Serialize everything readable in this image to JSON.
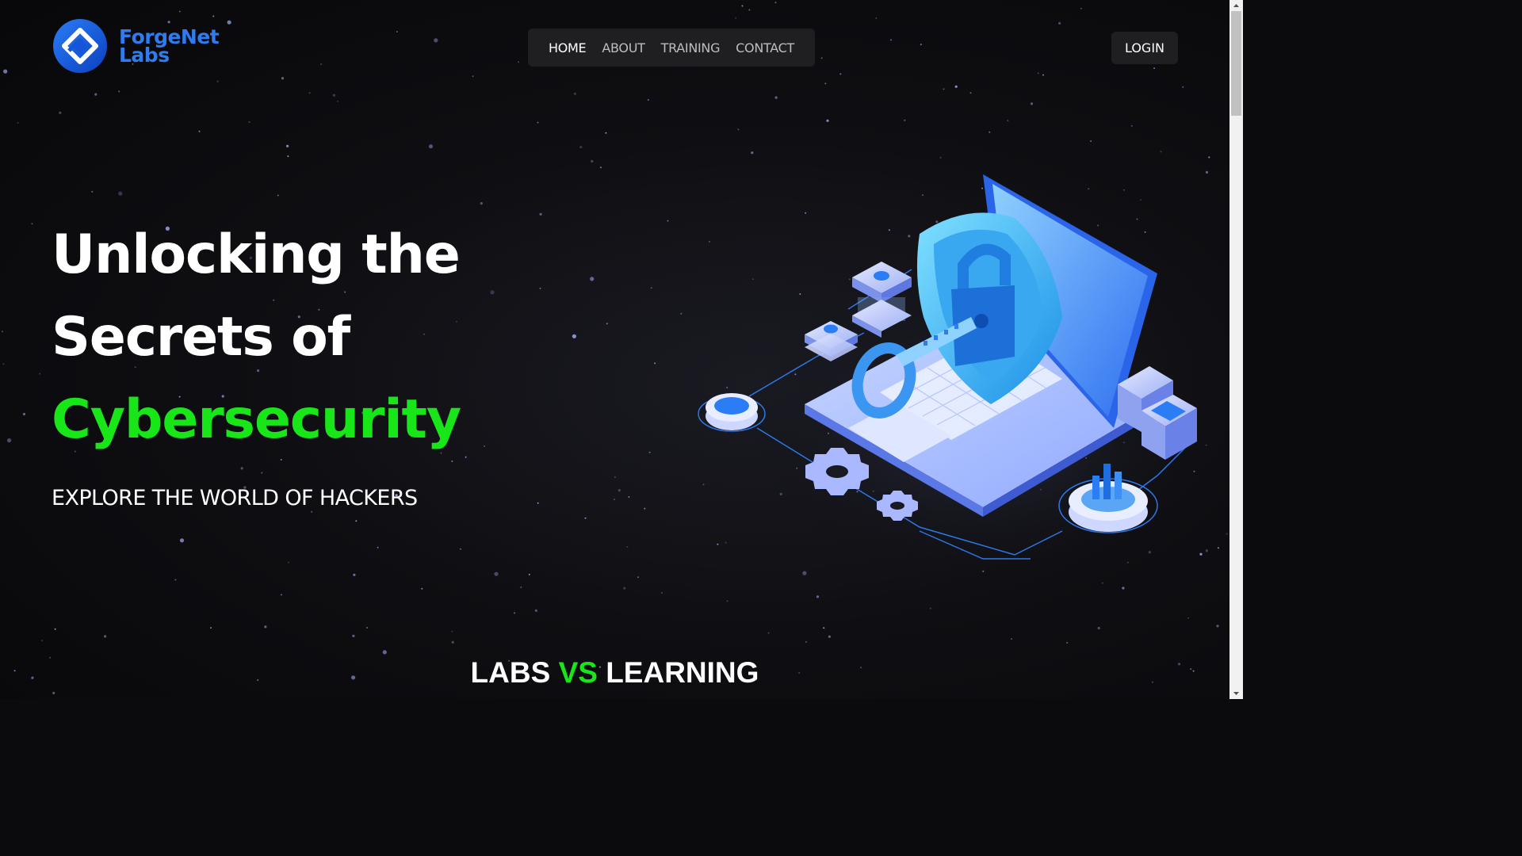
{
  "brand": {
    "name_line1": "ForgeNet",
    "name_line2": "Labs",
    "logo_icon": "diamond-logo-icon",
    "color": "#2f7cf0"
  },
  "nav": {
    "items": [
      {
        "label": "HOME",
        "active": true
      },
      {
        "label": "ABOUT",
        "active": false
      },
      {
        "label": "TRAINING",
        "active": false
      },
      {
        "label": "CONTACT",
        "active": false
      }
    ]
  },
  "login": {
    "label": "LOGIN"
  },
  "hero": {
    "title_line1": "Unlocking the",
    "title_line2": "Secrets of",
    "title_line3": "Cybersecurity",
    "subtitle": "EXPLORE THE WORLD OF HACKERS",
    "illustration": "laptop-shield-lock-key-illustration"
  },
  "section": {
    "title_part1": "LABS",
    "title_vs": "VS",
    "title_part2": "LEARNING"
  },
  "colors": {
    "background": "#0b0b0d",
    "accent_green": "#19e619",
    "brand_blue": "#2f7cf0",
    "nav_bg": "#1f1f22"
  }
}
